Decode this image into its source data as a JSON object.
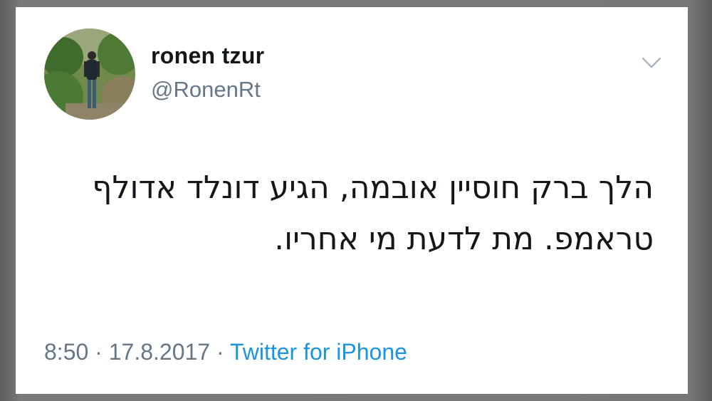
{
  "tweet": {
    "display_name": "ronen tzur",
    "handle": "@RonenRt",
    "text_line_1": "הלך ברק חוסיין אובמה, הגיע דונלד אדולף",
    "text_line_2": "טראמפ. מת לדעת מי אחריו.",
    "time": "8:50",
    "date": "17.8.2017",
    "separator": "·",
    "source": "Twitter for iPhone"
  },
  "icons": {
    "menu": "chevron-down-icon",
    "avatar": "avatar-photo"
  },
  "colors": {
    "name": "#14171a",
    "secondary": "#657786",
    "link": "#1b95e0",
    "card_bg": "#ffffff"
  }
}
